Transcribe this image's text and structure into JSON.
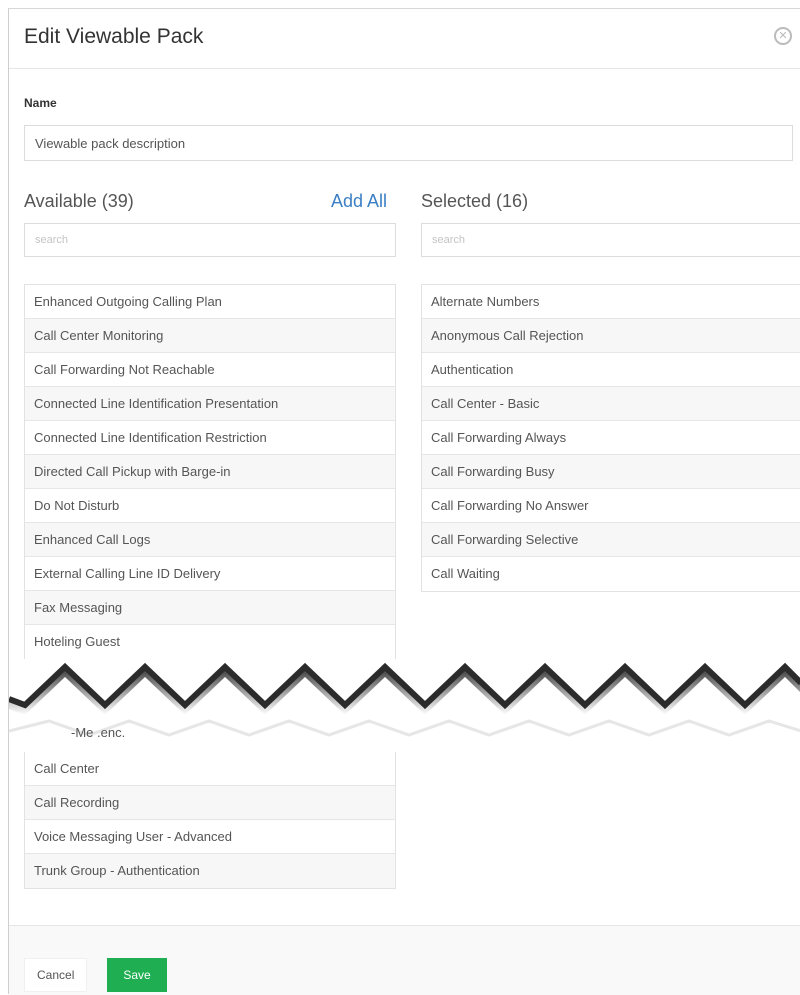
{
  "dialog": {
    "title": "Edit Viewable Pack",
    "close_icon": "close-circle-icon"
  },
  "name_field": {
    "label": "Name",
    "value": "Viewable pack description"
  },
  "available": {
    "title": "Available (39)",
    "add_all_label": "Add All",
    "search_placeholder": "search",
    "items_top": [
      "Enhanced Outgoing Calling Plan",
      "Call Center Monitoring",
      "Call Forwarding Not Reachable",
      "Connected Line Identification Presentation",
      "Connected Line Identification Restriction",
      "Directed Call Pickup with Barge-in",
      "Do Not Disturb",
      "Enhanced Call Logs",
      "External Calling Line ID Delivery",
      "Fax Messaging",
      "Hoteling Guest"
    ],
    "partial_item": "-Me        .enc.",
    "items_bottom": [
      "Call Center",
      "Call Recording",
      "Voice Messaging User - Advanced",
      "Trunk Group - Authentication"
    ]
  },
  "selected": {
    "title": "Selected (16)",
    "search_placeholder": "search",
    "items": [
      "Alternate Numbers",
      "Anonymous Call Rejection",
      "Authentication",
      "Call Center - Basic",
      "Call Forwarding Always",
      "Call Forwarding Busy",
      "Call Forwarding No Answer",
      "Call Forwarding Selective",
      "Call Waiting"
    ]
  },
  "footer": {
    "cancel_label": "Cancel",
    "save_label": "Save",
    "save_color": "#1fae52"
  }
}
